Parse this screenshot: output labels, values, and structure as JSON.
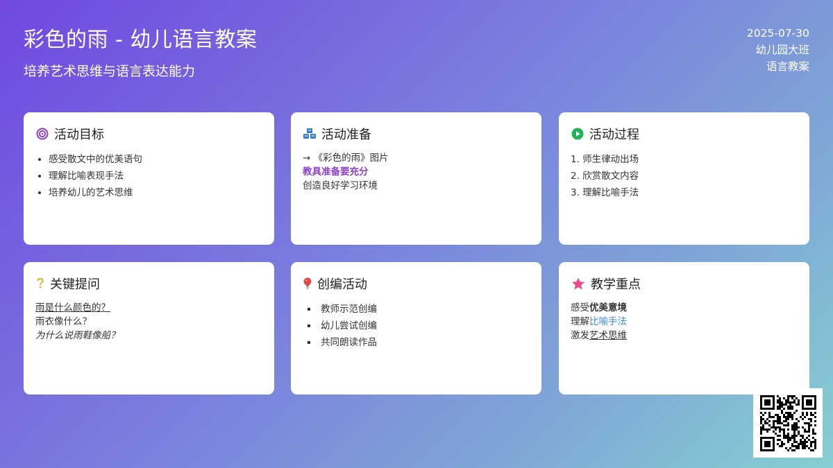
{
  "header": {
    "title": "彩色的雨 - 幼儿语言教案",
    "subtitle": "培养艺术思维与语言表达能力"
  },
  "meta": {
    "date": "2025-07-30",
    "class": "幼儿园大班",
    "type": "语言教案"
  },
  "cards": {
    "goals": {
      "title": "活动目标",
      "icon": "target-icon",
      "items": [
        "感受散文中的优美语句",
        "理解比喻表现手法",
        "培养幼儿的艺术思维"
      ]
    },
    "prep": {
      "title": "活动准备",
      "icon": "cubes-icon",
      "line1": "→ 《彩色的雨》图片",
      "line2": "教具准备要充分",
      "line3": "创造良好学习环境"
    },
    "process": {
      "title": "活动过程",
      "icon": "play-circle-icon",
      "items": [
        "1. 师生律动出场",
        "2. 欣赏散文内容",
        "3. 理解比喻手法"
      ]
    },
    "questions": {
      "title": "关键提问",
      "icon": "question-icon",
      "q1": "雨是什么颜色的？",
      "q2": "雨衣像什么？",
      "q3": "为什么说雨鞋像船？"
    },
    "creative": {
      "title": "创编活动",
      "icon": "lightbulb-icon",
      "items": [
        "教师示范创编",
        "幼儿尝试创编",
        "共同朗读作品"
      ]
    },
    "focus": {
      "title": "教学重点",
      "icon": "star-icon",
      "l1_prefix": "感受",
      "l1_em": "优美意境",
      "l2_prefix": "理解",
      "l2_em": "比喻手法",
      "l3_prefix": "激发",
      "l3_em": "艺术思维"
    }
  },
  "colors": {
    "purple": "#8b3fd6",
    "blue": "#3a8ad8",
    "green": "#22b455",
    "yellow": "#e8b020",
    "red": "#e04848",
    "pink": "#e84a8a"
  }
}
